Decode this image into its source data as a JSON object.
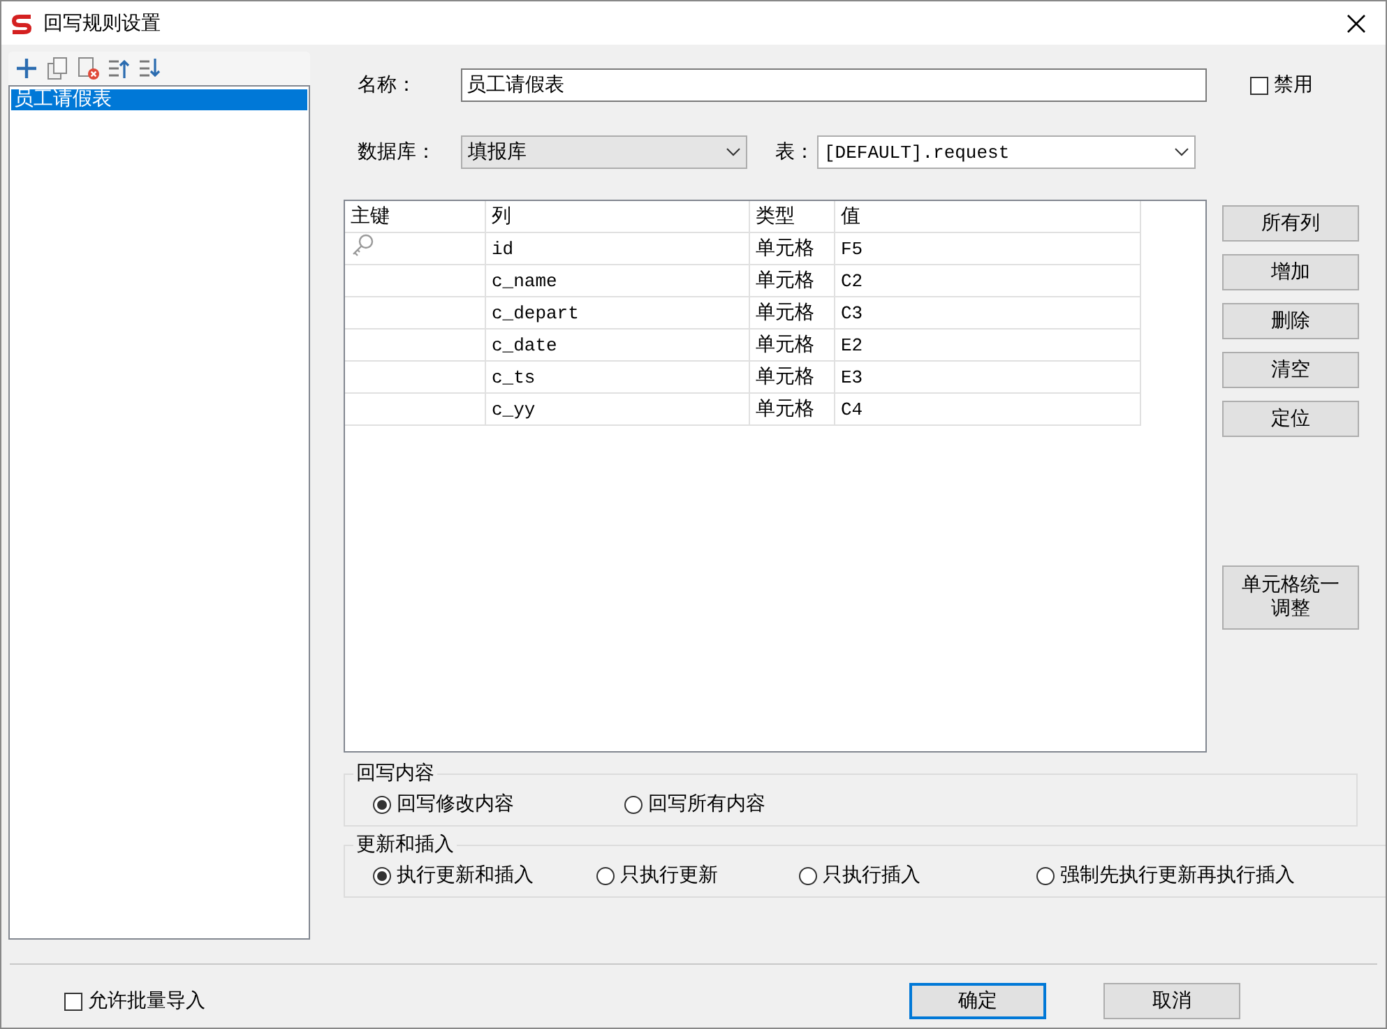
{
  "window": {
    "title": "回写规则设置"
  },
  "toolbar": {
    "items": [
      {
        "kind": "add"
      },
      {
        "kind": "copy"
      },
      {
        "kind": "delete"
      },
      {
        "kind": "up"
      },
      {
        "kind": "down"
      }
    ]
  },
  "rules": [
    {
      "label": "员工请假表",
      "selected": true
    }
  ],
  "name": {
    "label": "名称：",
    "value": "员工请假表"
  },
  "disabled": {
    "label": "禁用",
    "checked": false
  },
  "database": {
    "label": "数据库：",
    "value": "填报库"
  },
  "table_select": {
    "label": "表：",
    "value": "[DEFAULT].request"
  },
  "table": {
    "columns": [
      "主键",
      "列",
      "类型",
      "值"
    ],
    "rows": [
      {
        "primary_key": true,
        "column": "id",
        "type": "单元格",
        "value": "F5"
      },
      {
        "primary_key": false,
        "column": "c_name",
        "type": "单元格",
        "value": "C2"
      },
      {
        "primary_key": false,
        "column": "c_depart",
        "type": "单元格",
        "value": "C3"
      },
      {
        "primary_key": false,
        "column": "c_date",
        "type": "单元格",
        "value": "E2"
      },
      {
        "primary_key": false,
        "column": "c_ts",
        "type": "单元格",
        "value": "E3"
      },
      {
        "primary_key": false,
        "column": "c_yy",
        "type": "单元格",
        "value": "C4"
      }
    ]
  },
  "side_buttons": [
    "所有列",
    "增加",
    "删除",
    "清空",
    "定位"
  ],
  "adjust_button": "单元格统一调整",
  "groups": [
    {
      "title": "回写内容",
      "options": [
        {
          "label": "回写修改内容",
          "selected": true
        },
        {
          "label": "回写所有内容",
          "selected": false
        }
      ]
    },
    {
      "title": "更新和插入",
      "options": [
        {
          "label": "执行更新和插入",
          "selected": true
        },
        {
          "label": "只执行更新",
          "selected": false
        },
        {
          "label": "只执行插入",
          "selected": false
        },
        {
          "label": "强制先执行更新再执行插入",
          "selected": false
        }
      ]
    }
  ],
  "batch_import": {
    "label": "允许批量导入",
    "checked": false
  },
  "buttons": [
    "确定",
    "取消"
  ]
}
